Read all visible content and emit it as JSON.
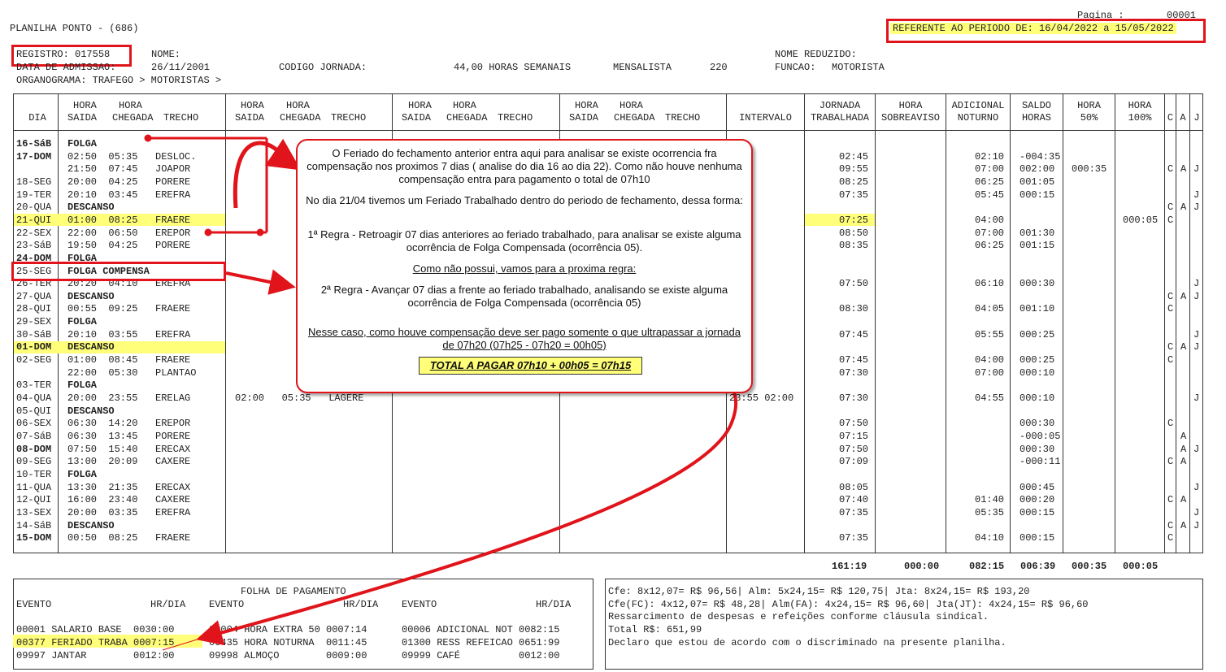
{
  "header": {
    "pagina_label": "Pagina :",
    "pagina_value": "00001",
    "title": "PLANILHA PONTO - (686)",
    "periodo": "REFERENTE AO PERIODO DE: 16/04/2022 a 15/05/2022",
    "registro": "REGISTRO: 017558",
    "nome_label": "NOME:",
    "nome_reduzido_label": "NOME REDUZIDO:",
    "data_admissao": "DATA DE ADMISSAO:",
    "data_admissao_value": "26/11/2001",
    "codigo_jornada": "CODIGO JORNADA:",
    "horas_semanais": "44,00 HORAS SEMANAIS",
    "mensalista": "MENSALISTA",
    "mensalista_num": "220",
    "funcao_label": "FUNCAO:",
    "funcao_value": "MOTORISTA",
    "organograma": "ORGANOGRAMA: TRAFEGO > MOTORISTAS >"
  },
  "columns": {
    "dia": "DIA",
    "hora": "HORA",
    "saida": "SAIDA",
    "chegada": "CHEGADA",
    "trecho": "TRECHO",
    "intervalo": "INTERVALO",
    "jornada1": "JORNADA",
    "jornada2": "TRABALHADA",
    "sobre1": "HORA",
    "sobre2": "SOBREAVISO",
    "adic1": "ADICIONAL",
    "adic2": "NOTURNO",
    "saldo1": "SALDO",
    "saldo2": "HORAS",
    "h50a": "HORA",
    "h50b": "50%",
    "h100a": "HORA",
    "h100b": "100%",
    "c": "C",
    "a": "A",
    "j": "J"
  },
  "rows": [
    {
      "dia": "16-SáB",
      "main": "FOLGA",
      "bold": true
    },
    {
      "dia": "17-DOM",
      "main": "02:50  05:35   DESLOC.",
      "jornada": "02:45",
      "adic": "02:10",
      "saldo": "-004:35",
      "bold": true
    },
    {
      "dia": "",
      "main": "21:50  07:45   JOAPOR",
      "jornada": "09:55",
      "adic": "07:00",
      "saldo": "002:00",
      "h50": "000:35",
      "c": "C",
      "a": "A",
      "j": "J"
    },
    {
      "dia": "18-SEG",
      "main": "20:00  04:25   PORERE",
      "jornada": "08:25",
      "adic": "06:25",
      "saldo": "001:05"
    },
    {
      "dia": "19-TER",
      "main": "20:10  03:45   EREFRA",
      "jornada": "07:35",
      "adic": "05:45",
      "saldo": "000:15",
      "j": "J"
    },
    {
      "dia": "20-QUA",
      "main": "DESCANSO",
      "c": "C",
      "a": "A",
      "j": "J"
    },
    {
      "dia": "21-QUI",
      "main": "01:00  08:25   FRAERE",
      "jornada": "07:25",
      "adic": "04:00",
      "h100": "000:05",
      "c": "C"
    },
    {
      "dia": "22-SEX",
      "main": "22:00  06:50   EREPOR",
      "jornada": "08:50",
      "adic": "07:00",
      "saldo": "001:30"
    },
    {
      "dia": "23-SáB",
      "main": "19:50  04:25   PORERE",
      "jornada": "08:35",
      "adic": "06:25",
      "saldo": "001:15"
    },
    {
      "dia": "24-DOM",
      "main": "FOLGA",
      "bold": true
    },
    {
      "dia": "25-SEG",
      "main": "FOLGA COMPENSA"
    },
    {
      "dia": "26-TER",
      "main": "20:20  04:10   EREFRA",
      "jornada": "07:50",
      "adic": "06:10",
      "saldo": "000:30",
      "j": "J"
    },
    {
      "dia": "27-QUA",
      "main": "DESCANSO",
      "c": "C",
      "a": "A",
      "j": "J"
    },
    {
      "dia": "28-QUI",
      "main": "00:55  09:25   FRAERE",
      "jornada": "08:30",
      "adic": "04:05",
      "saldo": "001:10",
      "c": "C"
    },
    {
      "dia": "29-SEX",
      "main": "FOLGA"
    },
    {
      "dia": "30-SáB",
      "main": "20:10  03:55   EREFRA",
      "jornada": "07:45",
      "adic": "05:55",
      "saldo": "000:25",
      "j": "J"
    },
    {
      "dia": "01-DOM",
      "main": "DESCANSO",
      "c": "C",
      "a": "A",
      "j": "J",
      "bold": true
    },
    {
      "dia": "02-SEG",
      "main": "01:00  08:45   FRAERE",
      "jornada": "07:45",
      "adic": "04:00",
      "saldo": "000:25",
      "c": "C"
    },
    {
      "dia": "",
      "main": "22:00  05:30   PLANTAO",
      "jornada": "07:30",
      "adic": "07:00",
      "saldo": "000:10"
    },
    {
      "dia": "03-TER",
      "main": "FOLGA"
    },
    {
      "dia": "04-QUA",
      "main": "20:00  23:55   ERELAG",
      "trecho2": "02:00   05:35   LAGERE",
      "intervalo": "23:55 02:00",
      "jornada": "07:30",
      "adic": "04:55",
      "saldo": "000:10",
      "j": "J"
    },
    {
      "dia": "05-QUI",
      "main": "DESCANSO"
    },
    {
      "dia": "06-SEX",
      "main": "06:30  14:20   EREPOR",
      "jornada": "07:50",
      "saldo": "000:30",
      "c": "C"
    },
    {
      "dia": "07-SáB",
      "main": "06:30  13:45   PORERE",
      "jornada": "07:15",
      "saldo": "-000:05",
      "a": "A"
    },
    {
      "dia": "08-DOM",
      "main": "07:50  15:40   ERECAX",
      "jornada": "07:50",
      "saldo": "000:30",
      "a": "A",
      "j": "J",
      "bold": true
    },
    {
      "dia": "09-SEG",
      "main": "13:00  20:09   CAXERE",
      "jornada": "07:09",
      "saldo": "-000:11",
      "c": "C",
      "a": "A"
    },
    {
      "dia": "10-TER",
      "main": "FOLGA"
    },
    {
      "dia": "11-QUA",
      "main": "13:30  21:35   ERECAX",
      "jornada": "08:05",
      "saldo": "000:45",
      "j": "J"
    },
    {
      "dia": "12-QUI",
      "main": "16:00  23:40   CAXERE",
      "jornada": "07:40",
      "adic": "01:40",
      "saldo": "000:20",
      "c": "C",
      "a": "A"
    },
    {
      "dia": "13-SEX",
      "main": "20:00  03:35   EREFRA",
      "jornada": "07:35",
      "adic": "05:35",
      "saldo": "000:15",
      "j": "J"
    },
    {
      "dia": "14-SáB",
      "main": "DESCANSO",
      "c": "C",
      "a": "A",
      "j": "J"
    },
    {
      "dia": "15-DOM",
      "main": "00:50  08:25   FRAERE",
      "jornada": "07:35",
      "adic": "04:10",
      "saldo": "000:15",
      "c": "C",
      "bold": true
    }
  ],
  "totals": {
    "jornada": "161:19",
    "sobre": "000:00",
    "adic": "082:15",
    "saldo": "006:39",
    "h50": "000:35",
    "h100": "000:05"
  },
  "callout": {
    "p1": "O Feriado do fechamento anterior entra aqui para analisar se existe ocorrencia fra compensação nos proximos 7 dias  ( analise do dia 16 ao dia 22). Como não houve nenhuma compensação entra para pagamento o total de 07h10",
    "p2": "No dia 21/04 tivemos um Feriado Trabalhado dentro do periodo de fechamento, dessa forma:",
    "p3": "1ª Regra - Retroagir 07 dias anteriores ao feriado trabalhado, para analisar se existe alguma ocorrência de Folga Compensada (ocorrência 05).",
    "p4": "Como não possui, vamos para a proxima regra:",
    "p5": "2ª Regra - Avançar 07 dias a frente ao feriado trabalhado, analisando se existe alguma ocorrência de Folga Compensada (ocorrência 05)",
    "p6": "Nesse caso, como houve compensação deve ser pago somente o que ultrapassar a jornada de 07h20 (07h25 - 07h20 = 00h05)",
    "total": "TOTAL A PAGAR 07h10 + 00h05 = 07h15"
  },
  "folha": {
    "title": "FOLHA DE PAGAMENTO",
    "evento": "EVENTO",
    "hrdia": "HR/DIA",
    "col1": [
      "00001 SALARIO BASE  0030:00",
      "00377 FERIADO TRABA 0007:15",
      "09997 JANTAR        0012:00"
    ],
    "col2": [
      "00004 HORA EXTRA 50 0007:14",
      "00435 HORA NOTURNA  0011:45",
      "09998 ALMOÇO        0009:00"
    ],
    "col3": [
      "00006 ADICIONAL NOT 0082:15",
      "01300 RESS REFEICAO 0651:99",
      "09999 CAFÉ          0012:00"
    ]
  },
  "resumo": {
    "l1": "Cfe: 8x12,07= R$ 96,56| Alm: 5x24,15= R$ 120,75| Jta: 8x24,15= R$ 193,20",
    "l2": "Cfe(FC): 4x12,07= R$ 48,28| Alm(FA): 4x24,15= R$ 96,60| Jta(JT): 4x24,15= R$ 96,60",
    "l3": "Ressarcimento de despesas e refeições conforme cláusula sindical.",
    "l4": "Total R$: 651,99",
    "l5": "Declaro que estou de acordo com o discriminado na presente planilha."
  },
  "colors": {
    "highlight": "#ffff7a",
    "annotation_red": "#e0141a"
  }
}
